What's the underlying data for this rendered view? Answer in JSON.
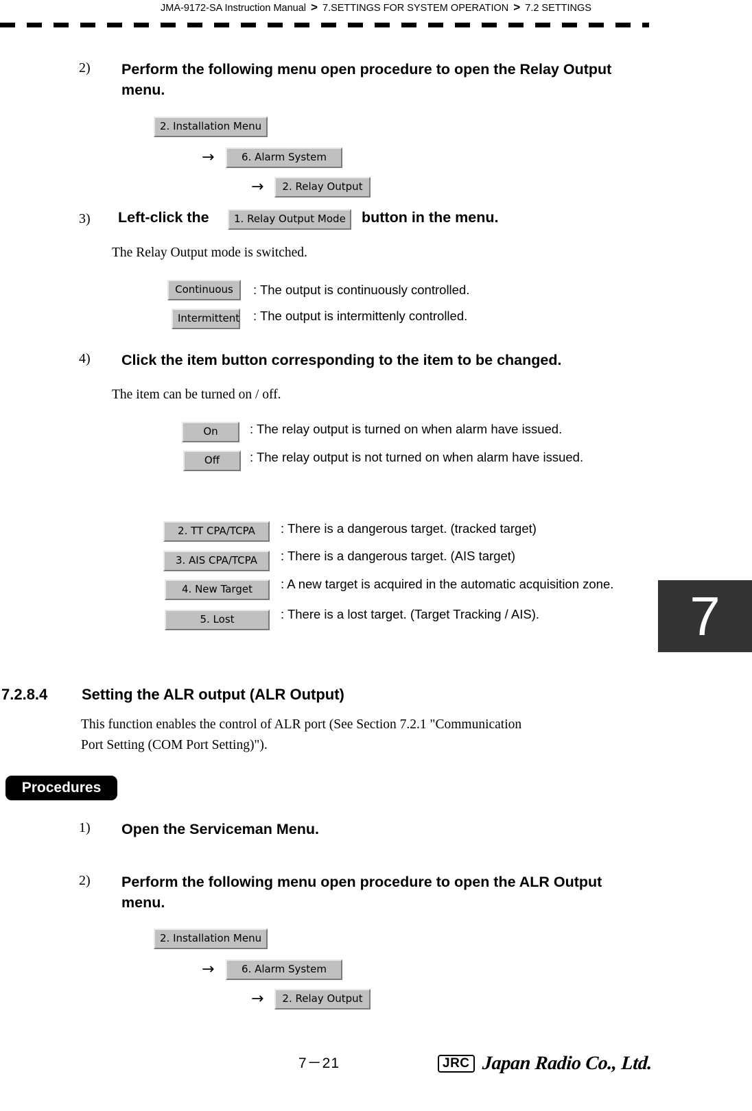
{
  "header": {
    "manual": "JMA-9172-SA Instruction Manual",
    "separator": ">",
    "chapter": "7.SETTINGS FOR SYSTEM OPERATION",
    "section": "7.2  SETTINGS"
  },
  "chapter_tab": {
    "number": "7"
  },
  "steps": {
    "step2_num": "2)",
    "step2_text": "Perform the following menu open procedure to open the Relay Output menu.",
    "step3_num": "3)",
    "step3_lead": "Left-click the",
    "step3_button": "1. Relay Output Mode",
    "step3_tail": "button in the menu.",
    "step3_note": "The Relay Output mode is switched.",
    "step4_num": "4)",
    "step4_text": "Click the item button corresponding to the item to be changed.",
    "step4_note": "The item can be turned on / off."
  },
  "menu_chain_relay": [
    {
      "label": "2. Installation Menu",
      "arrow": ""
    },
    {
      "label": "6. Alarm System",
      "arrow": "→"
    },
    {
      "label": "2. Relay Output",
      "arrow": "→"
    }
  ],
  "mode_options": [
    {
      "button": "Continuous",
      "description": ": The output is continuously controlled."
    },
    {
      "button": "Intermittent",
      "description": ": The output is intermittenly controlled."
    }
  ],
  "onoff_options": [
    {
      "button": "On",
      "description": ": The relay output is turned on when alarm have issued."
    },
    {
      "button": "Off",
      "description": ": The relay output is not turned on when alarm have issued."
    }
  ],
  "item_options": [
    {
      "button": "2. TT CPA/TCPA",
      "description": ": There is a dangerous target. (tracked target)"
    },
    {
      "button": "3. AIS CPA/TCPA",
      "description": ": There is a dangerous target. (AIS target)"
    },
    {
      "button": "4. New Target",
      "description": ": A new target is acquired in the automatic acquisition zone."
    },
    {
      "button": "5. Lost",
      "description": ": There is a lost target. (Target Tracking / AIS)."
    }
  ],
  "section": {
    "number": "7.2.8.4",
    "title": "Setting the ALR output  (ALR Output)",
    "body_line1": "This function enables the control of ALR port (See Section 7.2.1 \"Communication",
    "body_line2": "Port Setting (COM Port Setting)\")."
  },
  "procedures": {
    "badge": "Procedures",
    "step1_num": "1)",
    "step1_text": "Open the Serviceman Menu.",
    "step2_num": "2)",
    "step2_text": "Perform the following menu open procedure to open the ALR Output menu."
  },
  "menu_chain_alr": [
    {
      "label": "2. Installation Menu",
      "arrow": ""
    },
    {
      "label": "6. Alarm System",
      "arrow": "→"
    },
    {
      "label": "2. Relay Output",
      "arrow": "→"
    }
  ],
  "footer": {
    "page_number": "7－21",
    "logo_mark": "JRC",
    "logo_word": "Japan Radio Co., Ltd."
  }
}
